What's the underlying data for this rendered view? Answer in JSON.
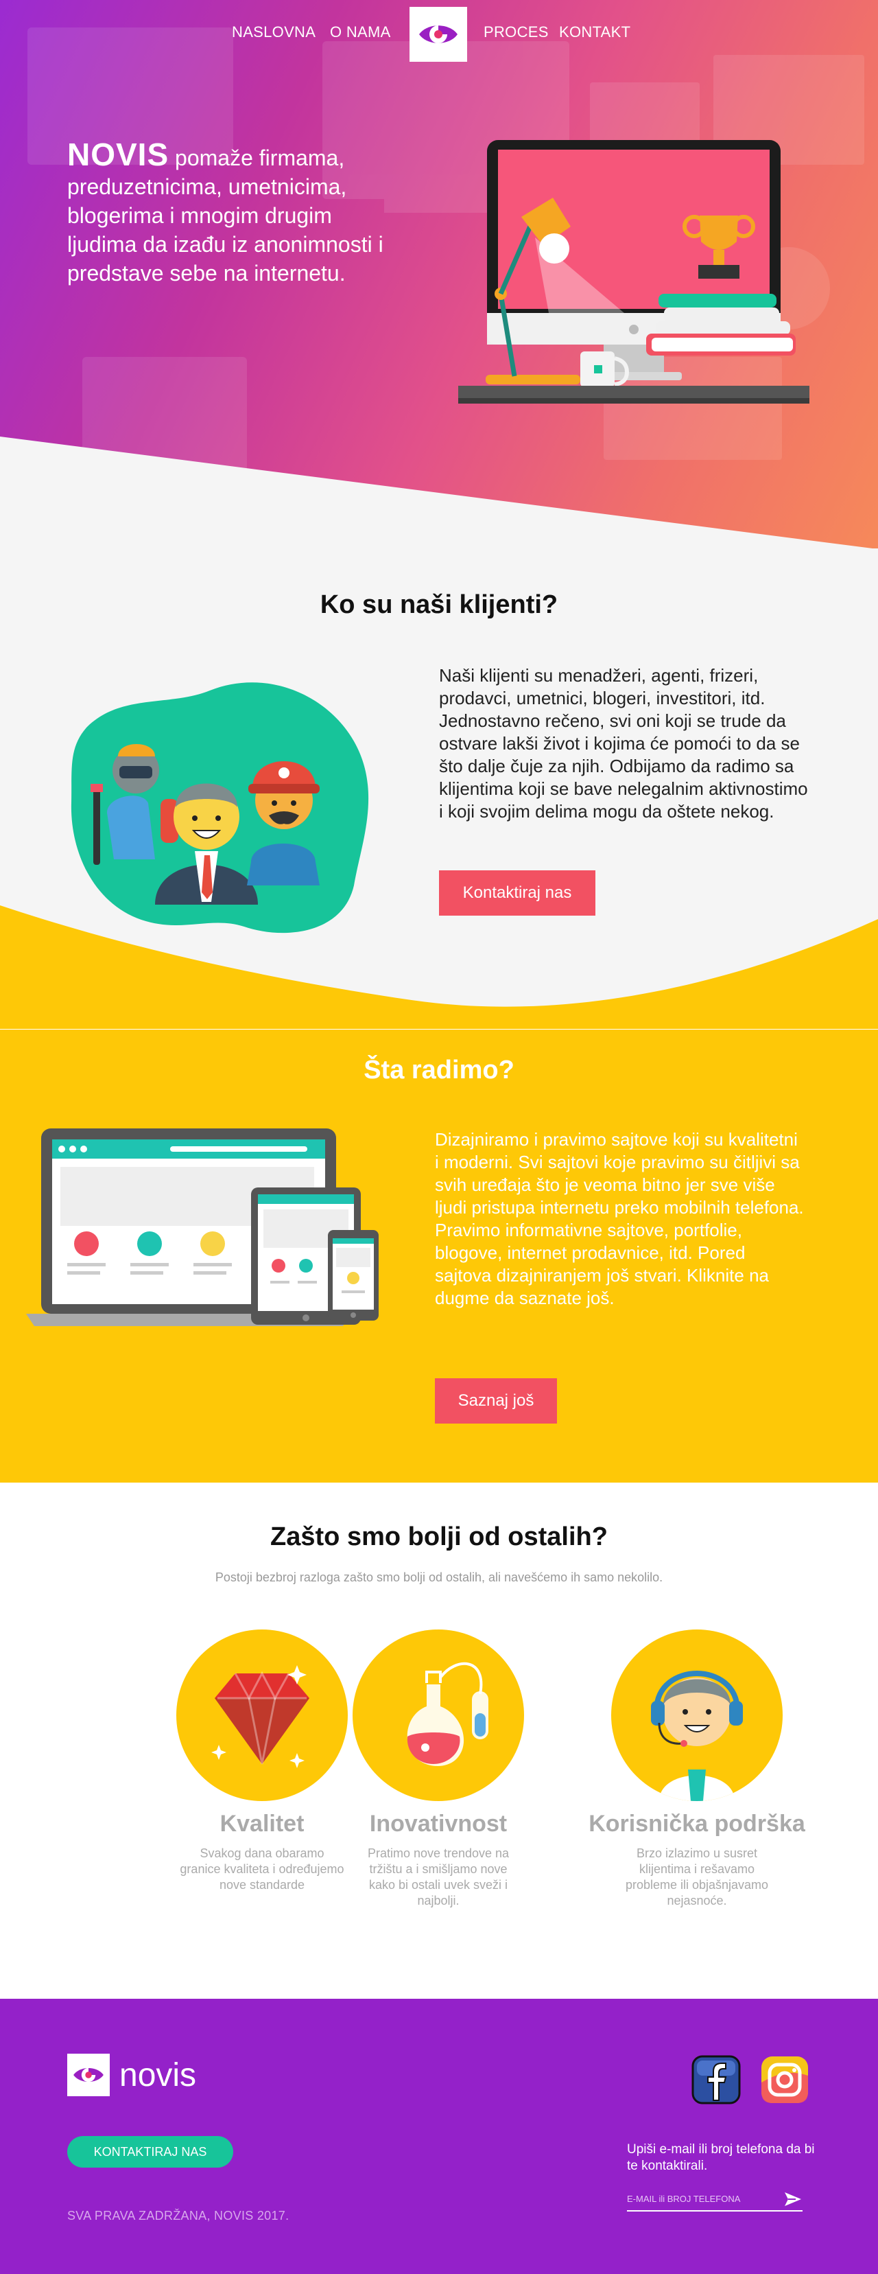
{
  "nav": {
    "links_left": [
      "NASLOVNA",
      "O NAMA"
    ],
    "links_right": [
      "PROCES",
      "KONTAKT"
    ],
    "logo_icon": "eye-logo-icon"
  },
  "hero": {
    "brand": "NOVIS",
    "text": " pomaže firmama, preduzetnicima, umetnicima, blogerima i mnogim drugim ljudima da izađu iz anonimnosti i predstave sebe na internetu."
  },
  "clients": {
    "title": "Ko su naši klijenti?",
    "text": "Naši klijenti su menadžeri, agenti, frizeri, prodavci, umetnici, blogeri, investitori, itd. Jednostavno rečeno, svi oni koji se trude da ostvare lakši život i kojima će pomoći to da se što dalje čuje za njih. Odbijamo da radimo sa klijentima koji se bave nelegalnim aktivnostimo i koji svojim delima mogu da oštete nekog.",
    "button": "Kontaktiraj nas"
  },
  "services": {
    "title": "Šta radimo?",
    "text": "Dizajniramo i pravimo sajtove koji su kvalitetni i moderni. Svi sajtovi koje pravimo su čitljivi sa svih uređaja što je veoma bitno jer sve više ljudi pristupa internetu preko mobilnih telefona. Pravimo informativne sajtove, portfolie, blogove, internet prodavnice, itd. Pored sajtova dizajniranjem još stvari. Kliknite na dugme da saznate još.",
    "button": "Saznaj još"
  },
  "why": {
    "title": "Zašto smo bolji od ostalih?",
    "subtitle": "Postoji bezbroj razloga zašto smo bolji od ostalih, ali navešćemo ih samo nekolilo.",
    "features": [
      {
        "title": "Kvalitet",
        "desc": "Svakog dana obaramo granice kvaliteta i određujemo nove standarde",
        "icon": "ruby-gem-icon"
      },
      {
        "title": "Inovativnost",
        "desc": "Pratimo nove trendove na tržištu a i smišljamo nove kako bi ostali uvek sveži i najbolji.",
        "icon": "lab-flask-icon"
      },
      {
        "title": "Korisnička podrška",
        "desc": "Brzo izlazimo u susret klijentima i rešavamo probleme ili objašnjavamo nejasnoće.",
        "icon": "support-agent-icon"
      }
    ]
  },
  "footer": {
    "logo_text": "novis",
    "button": "KONTAKTIRAJ NAS",
    "copyright": "SVA PRAVA ZADRŽANA, NOVIS 2017.",
    "note": "Upiši e-mail ili broj telefona da bi te kontaktirali.",
    "input_placeholder": "E-MAIL ili BROJ TELEFONA",
    "social": [
      "facebook-icon",
      "instagram-icon"
    ]
  },
  "colors": {
    "pink_button": "#f25162",
    "yellow": "#fec807",
    "purple": "#9421c9",
    "green": "#17c49a"
  }
}
